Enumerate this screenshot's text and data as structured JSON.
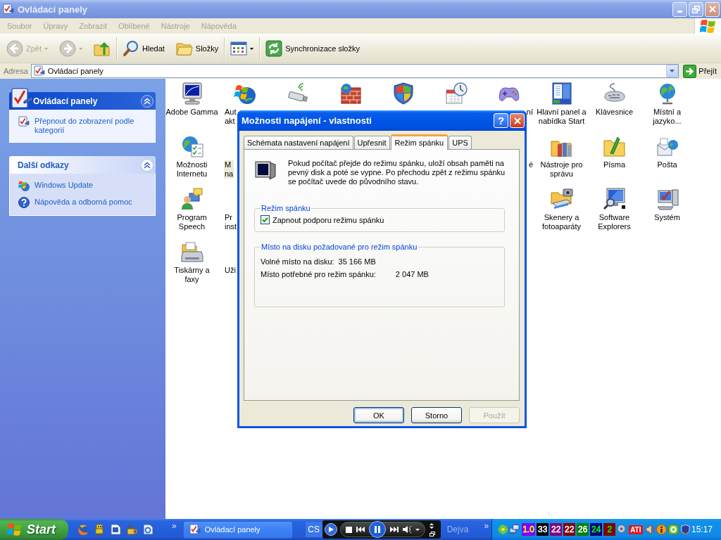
{
  "window": {
    "title": "Ovládací panely",
    "active": false
  },
  "menu": [
    "Soubor",
    "Úpravy",
    "Zobrazit",
    "Oblíbené",
    "Nástroje",
    "Nápověda"
  ],
  "toolbar": {
    "groups": [
      [
        {
          "kind": "back",
          "label": "Zpět",
          "disabled": true,
          "dropdown": true
        },
        {
          "kind": "forward",
          "disabled": true,
          "dropdown": true
        },
        {
          "kind": "up",
          "disabled": false,
          "dropdown": false
        }
      ],
      [
        {
          "kind": "search",
          "label": "Hledat",
          "disabled": false,
          "dropdown": false
        },
        {
          "kind": "folders",
          "label": "Složky",
          "disabled": false,
          "dropdown": false
        }
      ],
      [
        {
          "kind": "views",
          "disabled": false,
          "dropdown": true
        }
      ],
      [
        {
          "kind": "sync",
          "label": "Synchronizace složky",
          "disabled": false,
          "dropdown": false
        }
      ]
    ]
  },
  "address_bar": {
    "label": "Adresa",
    "value": "Ovládací panely",
    "go_button": "Přejít"
  },
  "task_pane": {
    "panels": [
      {
        "kind": "special",
        "title": "Ovládací panely",
        "expanded": true,
        "links": [
          {
            "kind": "switch-view",
            "label": "Přepnout do zobrazení podle kategorií"
          }
        ]
      },
      {
        "kind": "normal",
        "title": "Další odkazy",
        "expanded": true,
        "links": [
          {
            "kind": "update",
            "label": "Windows Update"
          },
          {
            "kind": "help",
            "label": "Nápověda a odborná pomoc"
          }
        ]
      }
    ]
  },
  "icon_view": {
    "rows": [
      [
        {
          "kind": "display",
          "label": "Adobe Gamma",
          "selected": false
        },
        {
          "kind": "updates",
          "label": "Aut\nakt",
          "selected": false,
          "cut_end": true
        },
        {
          "kind": "wireless",
          "selected": false
        },
        {
          "kind": "firewall",
          "selected": false
        },
        {
          "kind": "security",
          "selected": false
        },
        {
          "kind": "datetime",
          "selected": false
        },
        {
          "kind": "game-controllers",
          "label": "ní",
          "selected": false,
          "cut_start": true
        },
        {
          "kind": "taskbar",
          "label": "Hlavní panel a\nnabídka Start",
          "selected": false
        },
        {
          "kind": "keyboard",
          "label": "Klávesnice",
          "selected": false
        },
        {
          "kind": "regional",
          "label": "Místní a\njazyko...",
          "selected": false
        }
      ],
      [
        {
          "kind": "internet",
          "label": "Možnosti\nInternetu",
          "selected": false
        },
        {
          "label": "M\nna",
          "selected": true,
          "cut_end": true
        },
        null,
        null,
        null,
        null,
        {
          "label": "é",
          "selected": false,
          "cut_start": true
        },
        {
          "kind": "admin-tools",
          "label": "Nástroje pro\nsprávu",
          "selected": false
        },
        {
          "kind": "fonts",
          "label": "Písma",
          "selected": false
        },
        {
          "kind": "mail",
          "label": "Pošta",
          "selected": false
        }
      ],
      [
        {
          "kind": "speech",
          "label": "Program\nSpeech",
          "selected": false
        },
        {
          "label": "Pr\ninst",
          "selected": false,
          "cut_end": true
        },
        null,
        null,
        null,
        null,
        null,
        {
          "kind": "scanners",
          "label": "Skenery a\nfotoaparáty",
          "selected": false
        },
        {
          "kind": "software-explorers",
          "label": "Software\nExplorers",
          "selected": false
        },
        {
          "kind": "system",
          "label": "Systém",
          "selected": false
        }
      ],
      [
        {
          "kind": "printers",
          "label": "Tiskárny a\nfaxy",
          "selected": false
        },
        {
          "label": "Uži",
          "selected": false,
          "cut_end": true
        }
      ]
    ]
  },
  "dialog": {
    "title": "Možnosti napájení - vlastnosti",
    "active": true,
    "help_button": "?",
    "tabs": [
      {
        "label": "Schémata nastavení napájení",
        "selected": false
      },
      {
        "label": "Upřesnit",
        "selected": false
      },
      {
        "label": "Režim spánku",
        "selected": true
      },
      {
        "label": "UPS",
        "selected": false
      }
    ],
    "description": "Pokud počítač přejde do režimu spánku, uloží obsah paměti na pevný disk a poté se vypne. Po přechodu zpět z režimu spánku se počítač uvede do původního stavu.",
    "groups": [
      {
        "kind": "checkbox",
        "title": "Režim spánku",
        "checkbox": {
          "label": "Zapnout podporu režimu spánku",
          "checked": true
        }
      },
      {
        "kind": "info",
        "title": "Místo na disku požadované pro režim spánku",
        "rows": [
          {
            "label": "Volné místo na disku:",
            "value": "35 166 MB"
          },
          {
            "label": "Místo potřebné pro režim spánku:",
            "value": "2 047 MB"
          }
        ]
      }
    ],
    "buttons": [
      {
        "label": "OK",
        "default": true,
        "disabled": false
      },
      {
        "label": "Storno",
        "default": false,
        "disabled": false
      },
      {
        "label": "Použít",
        "default": false,
        "disabled": true
      }
    ]
  },
  "taskbar": {
    "start_button": "Start",
    "quick_launch_chevron": "»",
    "tasks": [
      {
        "label": "Ovládací panely",
        "selected": false
      }
    ],
    "language": "CS",
    "media_player": {
      "playing": true
    },
    "toolbar_label": "Dejva",
    "toolbar_chevron": "»",
    "tray": {
      "counters": [
        {
          "color": "#8000ff",
          "label": {
            "text": "1.0",
            "color": "#ffff00"
          }
        },
        {
          "color": "#000000",
          "label": {
            "text": "33",
            "color": "#ffffff"
          }
        },
        {
          "color": "#800080",
          "label": {
            "text": "22",
            "color": "#ffffff"
          }
        },
        {
          "color": "#800000",
          "label": {
            "text": "22",
            "color": "#ffffff"
          }
        },
        {
          "color": "#008000",
          "label": {
            "text": "26",
            "color": "#ffffff"
          }
        },
        {
          "color": "#000080",
          "label": {
            "text": "24",
            "color": "#00ff00"
          }
        },
        {
          "color": "#800000",
          "label": {
            "text": "2",
            "color": "#00ff00"
          }
        }
      ],
      "badge": "ATI",
      "clock": "15:17"
    }
  }
}
